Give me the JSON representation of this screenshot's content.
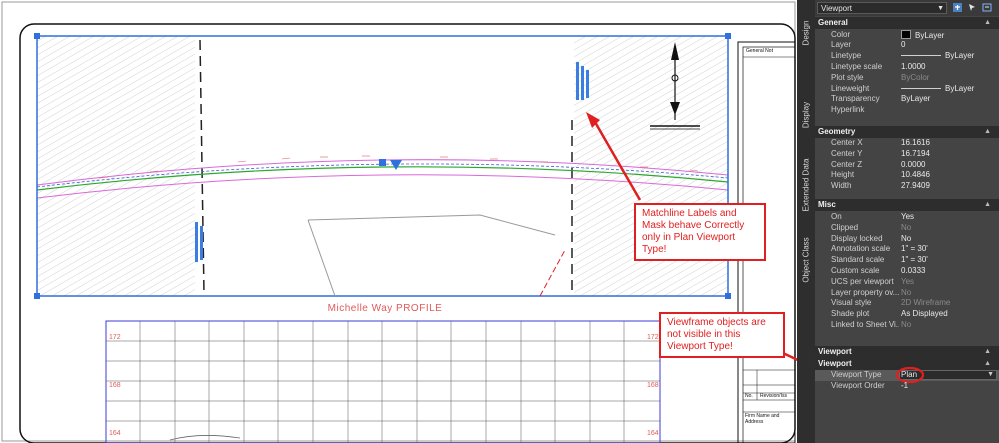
{
  "drawing": {
    "profile_title": "Michelle Way PROFILE",
    "axis_labels": {
      "left": [
        "172",
        "168",
        "164"
      ],
      "right": [
        "172",
        "168",
        "164"
      ]
    },
    "callouts": {
      "matchline": "Matchline Labels and Mask behave Correctly only in Plan Viewport Type!",
      "viewframe": "Viewframe objects are not visible in this Viewport Type!"
    },
    "titleblock": {
      "heading": "General Not",
      "rev_label": "Revision/Iss",
      "no_label": "No.",
      "firm_label": "Firm Name and Address"
    },
    "annotation_color": "#e02020"
  },
  "palette": {
    "selector": "Viewport",
    "side_tabs": [
      "Design",
      "Display",
      "Extended Data",
      "Object Class"
    ],
    "sections": {
      "general": "General",
      "geometry": "Geometry",
      "misc": "Misc",
      "viewport1": "Viewport",
      "viewport2": "Viewport"
    },
    "general": [
      {
        "k": "Color",
        "v": "ByLayer"
      },
      {
        "k": "Layer",
        "v": "0"
      },
      {
        "k": "Linetype",
        "v": "ByLayer"
      },
      {
        "k": "Linetype scale",
        "v": "1.0000"
      },
      {
        "k": "Plot style",
        "v": "ByColor"
      },
      {
        "k": "Lineweight",
        "v": "ByLayer"
      },
      {
        "k": "Transparency",
        "v": "ByLayer"
      },
      {
        "k": "Hyperlink",
        "v": ""
      }
    ],
    "geometry": [
      {
        "k": "Center X",
        "v": "16.1616"
      },
      {
        "k": "Center Y",
        "v": "16.7194"
      },
      {
        "k": "Center Z",
        "v": "0.0000"
      },
      {
        "k": "Height",
        "v": "10.4846"
      },
      {
        "k": "Width",
        "v": "27.9409"
      }
    ],
    "misc": [
      {
        "k": "On",
        "v": "Yes"
      },
      {
        "k": "Clipped",
        "v": "No"
      },
      {
        "k": "Display locked",
        "v": "No"
      },
      {
        "k": "Annotation scale",
        "v": "1\" = 30'"
      },
      {
        "k": "Standard scale",
        "v": "1\" = 30'"
      },
      {
        "k": "Custom scale",
        "v": "0.0333"
      },
      {
        "k": "UCS per viewport",
        "v": "Yes"
      },
      {
        "k": "Layer property ov...",
        "v": "No"
      },
      {
        "k": "Visual style",
        "v": "2D Wireframe"
      },
      {
        "k": "Shade plot",
        "v": "As Displayed"
      },
      {
        "k": "Linked to Sheet Vi...",
        "v": "No"
      }
    ],
    "viewport": [
      {
        "k": "Viewport Type",
        "v": "Plan"
      },
      {
        "k": "Viewport Order",
        "v": "-1"
      }
    ],
    "colors": {
      "panel": "#444444",
      "header": "#2d2d2d",
      "highlight": "#e02020"
    }
  }
}
